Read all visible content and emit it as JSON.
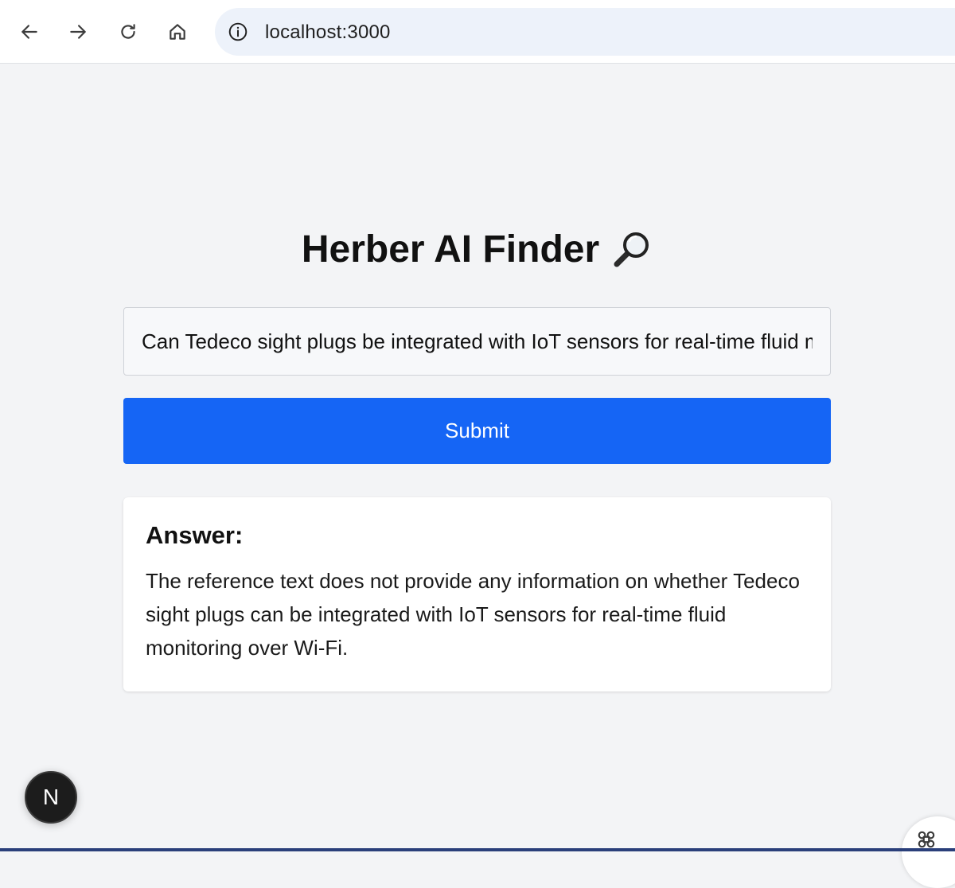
{
  "browser": {
    "url": "localhost:3000",
    "icons": [
      "back-icon",
      "forward-icon",
      "reload-icon",
      "home-icon",
      "site-info-icon"
    ]
  },
  "page": {
    "title": "Herber AI Finder",
    "title_icon": "magnifying-glass-icon",
    "query_value": "Can Tedeco sight plugs be integrated with IoT sensors for real-time fluid monitoring over Wi-Fi?",
    "submit_label": "Submit",
    "answer_heading": "Answer:",
    "answer_text": "The reference text does not provide any information on whether Tedeco sight plugs can be integrated with IoT sensors for real-time fluid monitoring over Wi-Fi.",
    "dev_badge_label": "N"
  },
  "colors": {
    "accent": "#1565f5",
    "background": "#f3f4f6",
    "card": "#ffffff"
  }
}
